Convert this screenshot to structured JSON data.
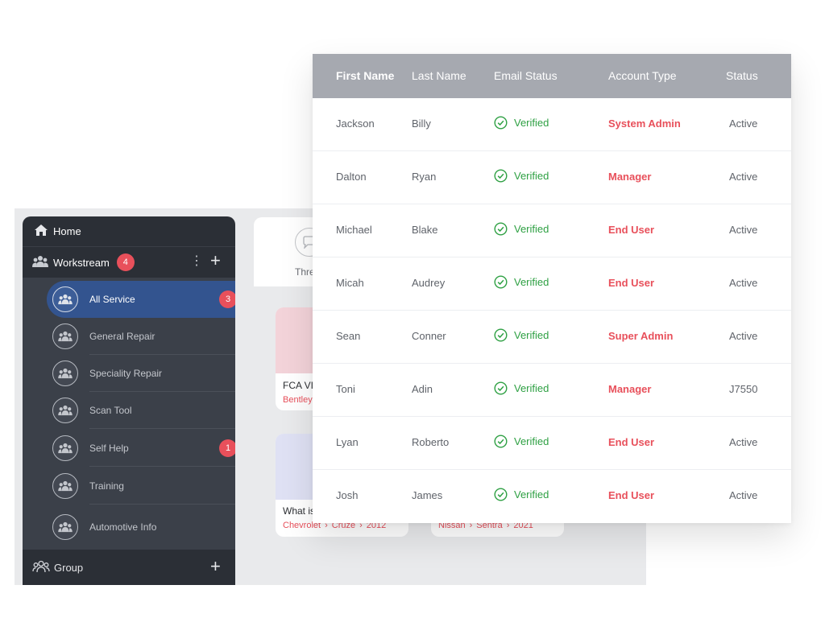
{
  "sidebar": {
    "home_label": "Home",
    "workstream_label": "Workstream",
    "workstream_badge": "4",
    "items": [
      {
        "label": "All Service",
        "badge": "3",
        "active": true
      },
      {
        "label": "General Repair"
      },
      {
        "label": "Speciality Repair"
      },
      {
        "label": "Scan Tool"
      },
      {
        "label": "Self Help",
        "badge": "1"
      },
      {
        "label": "Training"
      },
      {
        "label": "Automotive Info"
      }
    ],
    "group_label": "Group"
  },
  "content": {
    "threads_label": "Thre",
    "cards": [
      {
        "title": "FCA VI",
        "meta": [
          "Bentley"
        ],
        "thumb_color": "#f3d3d9"
      },
      {
        "title": "What is",
        "meta": [
          "Chevrolet",
          "Cruze",
          "2012"
        ],
        "thumb_color": "#dfe1f4"
      },
      {
        "title": "",
        "meta": [
          "Nissan",
          "Sentra",
          "2021"
        ],
        "thumb_color": ""
      }
    ]
  },
  "table": {
    "columns": [
      "First Name",
      "Last Name",
      "Email Status",
      "Account Type",
      "Status"
    ],
    "rows": [
      {
        "first": "Jackson",
        "last": "Billy",
        "email": "Verified",
        "account": "System Admin",
        "status": "Active"
      },
      {
        "first": "Dalton",
        "last": "Ryan",
        "email": "Verified",
        "account": "Manager",
        "status": "Active"
      },
      {
        "first": "Michael",
        "last": "Blake",
        "email": "Verified",
        "account": "End User",
        "status": "Active"
      },
      {
        "first": "Micah",
        "last": "Audrey",
        "email": "Verified",
        "account": "End User",
        "status": "Active"
      },
      {
        "first": "Sean",
        "last": "Conner",
        "email": "Verified",
        "account": "Super Admin",
        "status": "Active"
      },
      {
        "first": "Toni",
        "last": "Adin",
        "email": "Verified",
        "account": "Manager",
        "status": "J7550"
      },
      {
        "first": "Lyan",
        "last": "Roberto",
        "email": "Verified",
        "account": "End User",
        "status": "Active"
      },
      {
        "first": "Josh",
        "last": "James",
        "email": "Verified",
        "account": "End User",
        "status": "Active"
      }
    ]
  },
  "colors": {
    "accent_red": "#e8505b",
    "verified_green": "#2ea043",
    "active_blue": "#33548f",
    "header_gray": "#a6a9b0"
  },
  "icons": {
    "home": "home-icon",
    "workstream": "team-icon",
    "group": "group-icon",
    "verified": "check-circle-icon",
    "threads": "chat-bubble-icon"
  }
}
